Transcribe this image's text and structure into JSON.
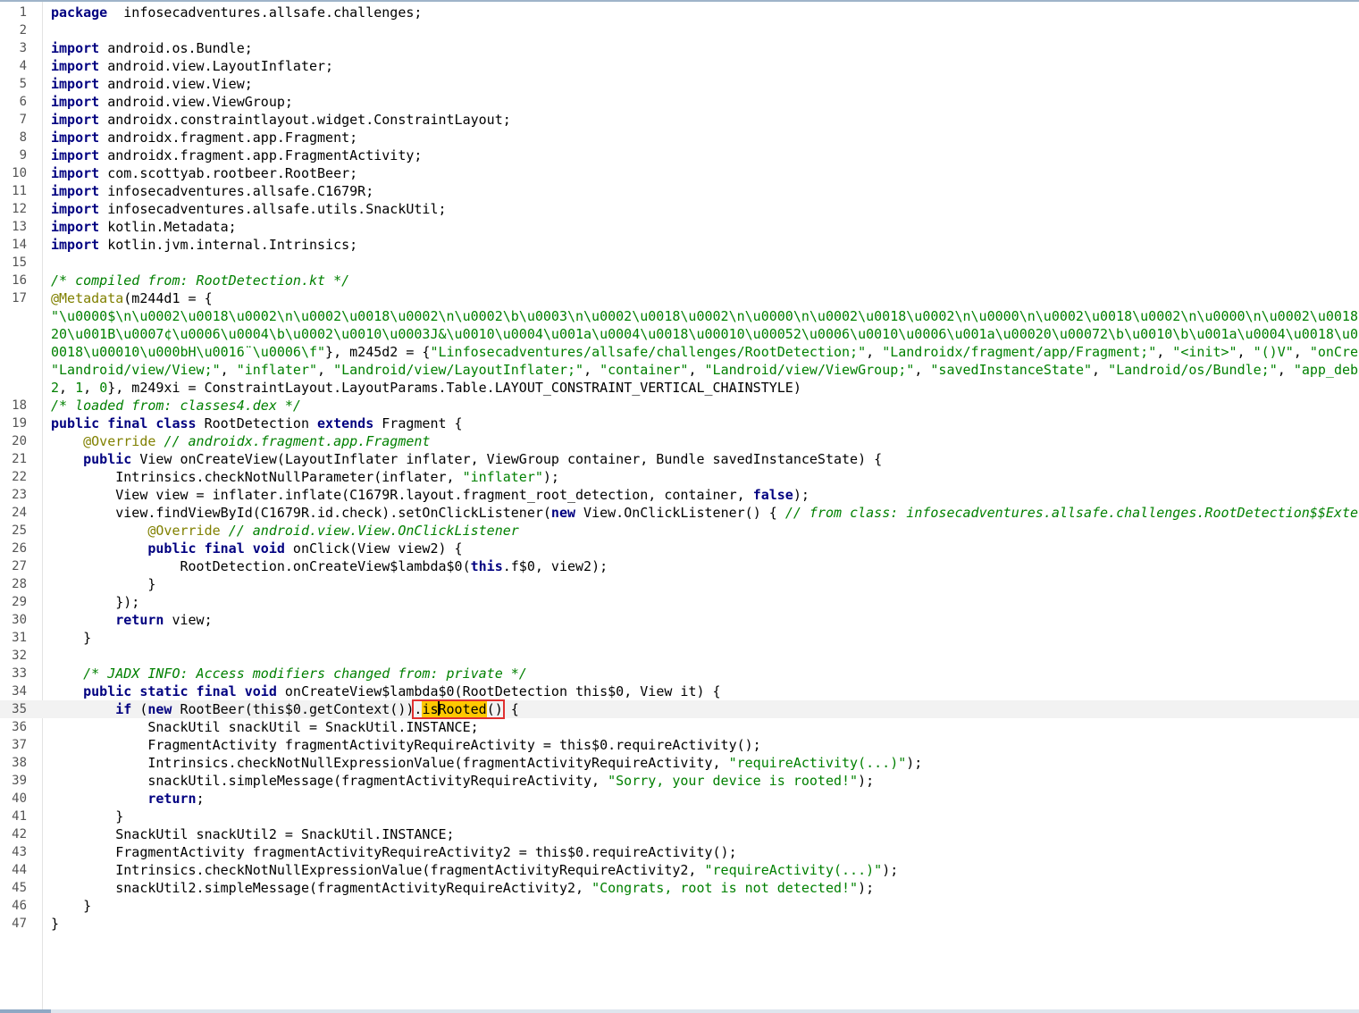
{
  "editor": {
    "lines": [
      {
        "n": "1",
        "segs": [
          [
            "kw",
            "package"
          ],
          [
            "",
            "  infosecadventures.allsafe.challenges;"
          ]
        ]
      },
      {
        "n": "2",
        "segs": []
      },
      {
        "n": "3",
        "segs": [
          [
            "kw",
            "import"
          ],
          [
            "",
            " android.os.Bundle;"
          ]
        ]
      },
      {
        "n": "4",
        "segs": [
          [
            "kw",
            "import"
          ],
          [
            "",
            " android.view.LayoutInflater;"
          ]
        ]
      },
      {
        "n": "5",
        "segs": [
          [
            "kw",
            "import"
          ],
          [
            "",
            " android.view.View;"
          ]
        ]
      },
      {
        "n": "6",
        "segs": [
          [
            "kw",
            "import"
          ],
          [
            "",
            " android.view.ViewGroup;"
          ]
        ]
      },
      {
        "n": "7",
        "segs": [
          [
            "kw",
            "import"
          ],
          [
            "",
            " androidx.constraintlayout.widget.ConstraintLayout;"
          ]
        ]
      },
      {
        "n": "8",
        "segs": [
          [
            "kw",
            "import"
          ],
          [
            "",
            " androidx.fragment.app.Fragment;"
          ]
        ]
      },
      {
        "n": "9",
        "segs": [
          [
            "kw",
            "import"
          ],
          [
            "",
            " androidx.fragment.app.FragmentActivity;"
          ]
        ]
      },
      {
        "n": "10",
        "segs": [
          [
            "kw",
            "import"
          ],
          [
            "",
            " com.scottyab.rootbeer.RootBeer;"
          ]
        ]
      },
      {
        "n": "11",
        "segs": [
          [
            "kw",
            "import"
          ],
          [
            "",
            " infosecadventures.allsafe.C1679R;"
          ]
        ]
      },
      {
        "n": "12",
        "segs": [
          [
            "kw",
            "import"
          ],
          [
            "",
            " infosecadventures.allsafe.utils.SnackUtil;"
          ]
        ]
      },
      {
        "n": "13",
        "segs": [
          [
            "kw",
            "import"
          ],
          [
            "",
            " kotlin.Metadata;"
          ]
        ]
      },
      {
        "n": "14",
        "segs": [
          [
            "kw",
            "import"
          ],
          [
            "",
            " kotlin.jvm.internal.Intrinsics;"
          ]
        ]
      },
      {
        "n": "15",
        "segs": []
      },
      {
        "n": "16",
        "segs": [
          [
            "cmt",
            "/* compiled from: RootDetection.kt */"
          ]
        ]
      },
      {
        "n": "17",
        "segs": [
          [
            "ann",
            "@Metadata"
          ],
          [
            "",
            "(m244d1 = {"
          ]
        ]
      },
      {
        "n": "",
        "segs": [
          [
            "str",
            "\"\\u0000$\\n\\u0002\\u0018\\u0002\\n\\u0002\\u0018\\u0002\\n\\u0002\\b\\u0003\\n\\u0002\\u0018\\u0002\\n\\u0000\\n\\u0002\\u0018\\u0002\\n\\u0000\\n\\u0002\\u0018\\u0002\\n\\u0000\\n\\u0002\\u0018\\"
          ]
        ]
      },
      {
        "n": "",
        "segs": [
          [
            "str",
            "20\\u001B\\u0007¢\\u0006\\u0004\\b\\u0002\\u0010\\u0003J&\\u0010\\u0004\\u001a\\u0004\\u0018\\u00010\\u00052\\u0006\\u0010\\u0006\\u001a\\u00020\\u00072\\b\\u0010\\b\\u001a\\u0004\\u0018\\u0"
          ]
        ]
      },
      {
        "n": "",
        "segs": [
          [
            "str",
            "0018\\u00010\\u000bH\\u0016¨\\u0006\\f\""
          ],
          [
            "",
            "}, m245d2 = {"
          ],
          [
            "str",
            "\"Linfosecadventures/allsafe/challenges/RootDetection;\""
          ],
          [
            "",
            ", "
          ],
          [
            "str",
            "\"Landroidx/fragment/app/Fragment;\""
          ],
          [
            "",
            ", "
          ],
          [
            "str",
            "\"<init>\""
          ],
          [
            "",
            ", "
          ],
          [
            "str",
            "\"()V\""
          ],
          [
            "",
            ", "
          ],
          [
            "str",
            "\"onCrea"
          ]
        ]
      },
      {
        "n": "",
        "segs": [
          [
            "str",
            "\"Landroid/view/View;\""
          ],
          [
            "",
            ", "
          ],
          [
            "str",
            "\"inflater\""
          ],
          [
            "",
            ", "
          ],
          [
            "str",
            "\"Landroid/view/LayoutInflater;\""
          ],
          [
            "",
            ", "
          ],
          [
            "str",
            "\"container\""
          ],
          [
            "",
            ", "
          ],
          [
            "str",
            "\"Landroid/view/ViewGroup;\""
          ],
          [
            "",
            ", "
          ],
          [
            "str",
            "\"savedInstanceState\""
          ],
          [
            "",
            ", "
          ],
          [
            "str",
            "\"Landroid/os/Bundle;\""
          ],
          [
            "",
            ", "
          ],
          [
            "str",
            "\"app_debu"
          ]
        ]
      },
      {
        "n": "",
        "segs": [
          [
            "str",
            "2"
          ],
          [
            "",
            ", "
          ],
          [
            "str",
            "1"
          ],
          [
            "",
            ", "
          ],
          [
            "str",
            "0"
          ],
          [
            "",
            "}, m249xi = ConstraintLayout.LayoutParams.Table.LAYOUT_CONSTRAINT_VERTICAL_CHAINSTYLE)"
          ]
        ]
      },
      {
        "n": "18",
        "segs": [
          [
            "cmt",
            "/* loaded from: classes4.dex */"
          ]
        ]
      },
      {
        "n": "19",
        "segs": [
          [
            "kw",
            "public final class"
          ],
          [
            "",
            " RootDetection "
          ],
          [
            "kw",
            "extends"
          ],
          [
            "",
            " Fragment {"
          ]
        ]
      },
      {
        "n": "20",
        "segs": [
          [
            "",
            "    "
          ],
          [
            "ann",
            "@Override"
          ],
          [
            "",
            " "
          ],
          [
            "cmt",
            "// androidx.fragment.app.Fragment"
          ]
        ]
      },
      {
        "n": "21",
        "segs": [
          [
            "",
            "    "
          ],
          [
            "kw",
            "public"
          ],
          [
            "",
            " View onCreateView(LayoutInflater inflater, ViewGroup container, Bundle savedInstanceState) {"
          ]
        ]
      },
      {
        "n": "22",
        "segs": [
          [
            "",
            "        Intrinsics.checkNotNullParameter(inflater, "
          ],
          [
            "str",
            "\"inflater\""
          ],
          [
            "",
            ");"
          ]
        ]
      },
      {
        "n": "23",
        "segs": [
          [
            "",
            "        View view = inflater.inflate(C1679R.layout.fragment_root_detection, container, "
          ],
          [
            "kw",
            "false"
          ],
          [
            "",
            ");"
          ]
        ]
      },
      {
        "n": "24",
        "segs": [
          [
            "",
            "        view.findViewById(C1679R.id.check).setOnClickListener("
          ],
          [
            "kw",
            "new"
          ],
          [
            "",
            " View.OnClickListener() { "
          ],
          [
            "cmt",
            "// from class: infosecadventures.allsafe.challenges.RootDetection$$Exter"
          ]
        ]
      },
      {
        "n": "25",
        "segs": [
          [
            "",
            "            "
          ],
          [
            "ann",
            "@Override"
          ],
          [
            "",
            " "
          ],
          [
            "cmt",
            "// android.view.View.OnClickListener"
          ]
        ]
      },
      {
        "n": "26",
        "segs": [
          [
            "",
            "            "
          ],
          [
            "kw",
            "public final void"
          ],
          [
            "",
            " onClick(View view2) {"
          ]
        ]
      },
      {
        "n": "27",
        "segs": [
          [
            "",
            "                RootDetection.onCreateView$lambda$0("
          ],
          [
            "kw",
            "this"
          ],
          [
            "",
            ".f$0, view2);"
          ]
        ]
      },
      {
        "n": "28",
        "segs": [
          [
            "",
            "            }"
          ]
        ]
      },
      {
        "n": "29",
        "segs": [
          [
            "",
            "        });"
          ]
        ]
      },
      {
        "n": "30",
        "segs": [
          [
            "",
            "        "
          ],
          [
            "kw",
            "return"
          ],
          [
            "",
            " view;"
          ]
        ]
      },
      {
        "n": "31",
        "segs": [
          [
            "",
            "    }"
          ]
        ]
      },
      {
        "n": "32",
        "segs": []
      },
      {
        "n": "33",
        "segs": [
          [
            "",
            "    "
          ],
          [
            "cmt",
            "/* JADX INFO: Access modifiers changed from: private */"
          ]
        ]
      },
      {
        "n": "34",
        "segs": [
          [
            "",
            "    "
          ],
          [
            "kw",
            "public static final void"
          ],
          [
            "",
            " onCreateView$lambda$0(RootDetection this$0, View it) {"
          ]
        ]
      },
      {
        "n": "35",
        "current": true,
        "segs": [
          [
            "",
            "        "
          ],
          [
            "kw",
            "if"
          ],
          [
            "",
            " ("
          ],
          [
            "kw",
            "new"
          ],
          [
            "",
            " RootBeer(this$0.getContext())"
          ],
          [
            "selbox",
            ".isRooted()"
          ],
          [
            "",
            " {"
          ]
        ]
      },
      {
        "n": "36",
        "segs": [
          [
            "",
            "            SnackUtil snackUtil = SnackUtil.INSTANCE;"
          ]
        ]
      },
      {
        "n": "37",
        "segs": [
          [
            "",
            "            FragmentActivity fragmentActivityRequireActivity = this$0.requireActivity();"
          ]
        ]
      },
      {
        "n": "38",
        "segs": [
          [
            "",
            "            Intrinsics.checkNotNullExpressionValue(fragmentActivityRequireActivity, "
          ],
          [
            "str",
            "\"requireActivity(...)\""
          ],
          [
            "",
            ");"
          ]
        ]
      },
      {
        "n": "39",
        "segs": [
          [
            "",
            "            snackUtil.simpleMessage(fragmentActivityRequireActivity, "
          ],
          [
            "str",
            "\"Sorry, your device is rooted!\""
          ],
          [
            "",
            ");"
          ]
        ]
      },
      {
        "n": "40",
        "segs": [
          [
            "",
            "            "
          ],
          [
            "kw",
            "return"
          ],
          [
            "",
            ";"
          ]
        ]
      },
      {
        "n": "41",
        "segs": [
          [
            "",
            "        }"
          ]
        ]
      },
      {
        "n": "42",
        "segs": [
          [
            "",
            "        SnackUtil snackUtil2 = SnackUtil.INSTANCE;"
          ]
        ]
      },
      {
        "n": "43",
        "segs": [
          [
            "",
            "        FragmentActivity fragmentActivityRequireActivity2 = this$0.requireActivity();"
          ]
        ]
      },
      {
        "n": "44",
        "segs": [
          [
            "",
            "        Intrinsics.checkNotNullExpressionValue(fragmentActivityRequireActivity2, "
          ],
          [
            "str",
            "\"requireActivity(...)\""
          ],
          [
            "",
            ");"
          ]
        ]
      },
      {
        "n": "45",
        "segs": [
          [
            "",
            "        snackUtil2.simpleMessage(fragmentActivityRequireActivity2, "
          ],
          [
            "str",
            "\"Congrats, root is not detected!\""
          ],
          [
            "",
            ");"
          ]
        ]
      },
      {
        "n": "46",
        "segs": [
          [
            "",
            "    }"
          ]
        ]
      },
      {
        "n": "47",
        "segs": [
          [
            "",
            "}"
          ]
        ]
      }
    ]
  },
  "colors": {
    "keyword": "#000080",
    "string": "#008000",
    "comment": "#008000",
    "annotation": "#808000",
    "search_highlight": "#ffc800",
    "selection_box": "#e03030"
  }
}
